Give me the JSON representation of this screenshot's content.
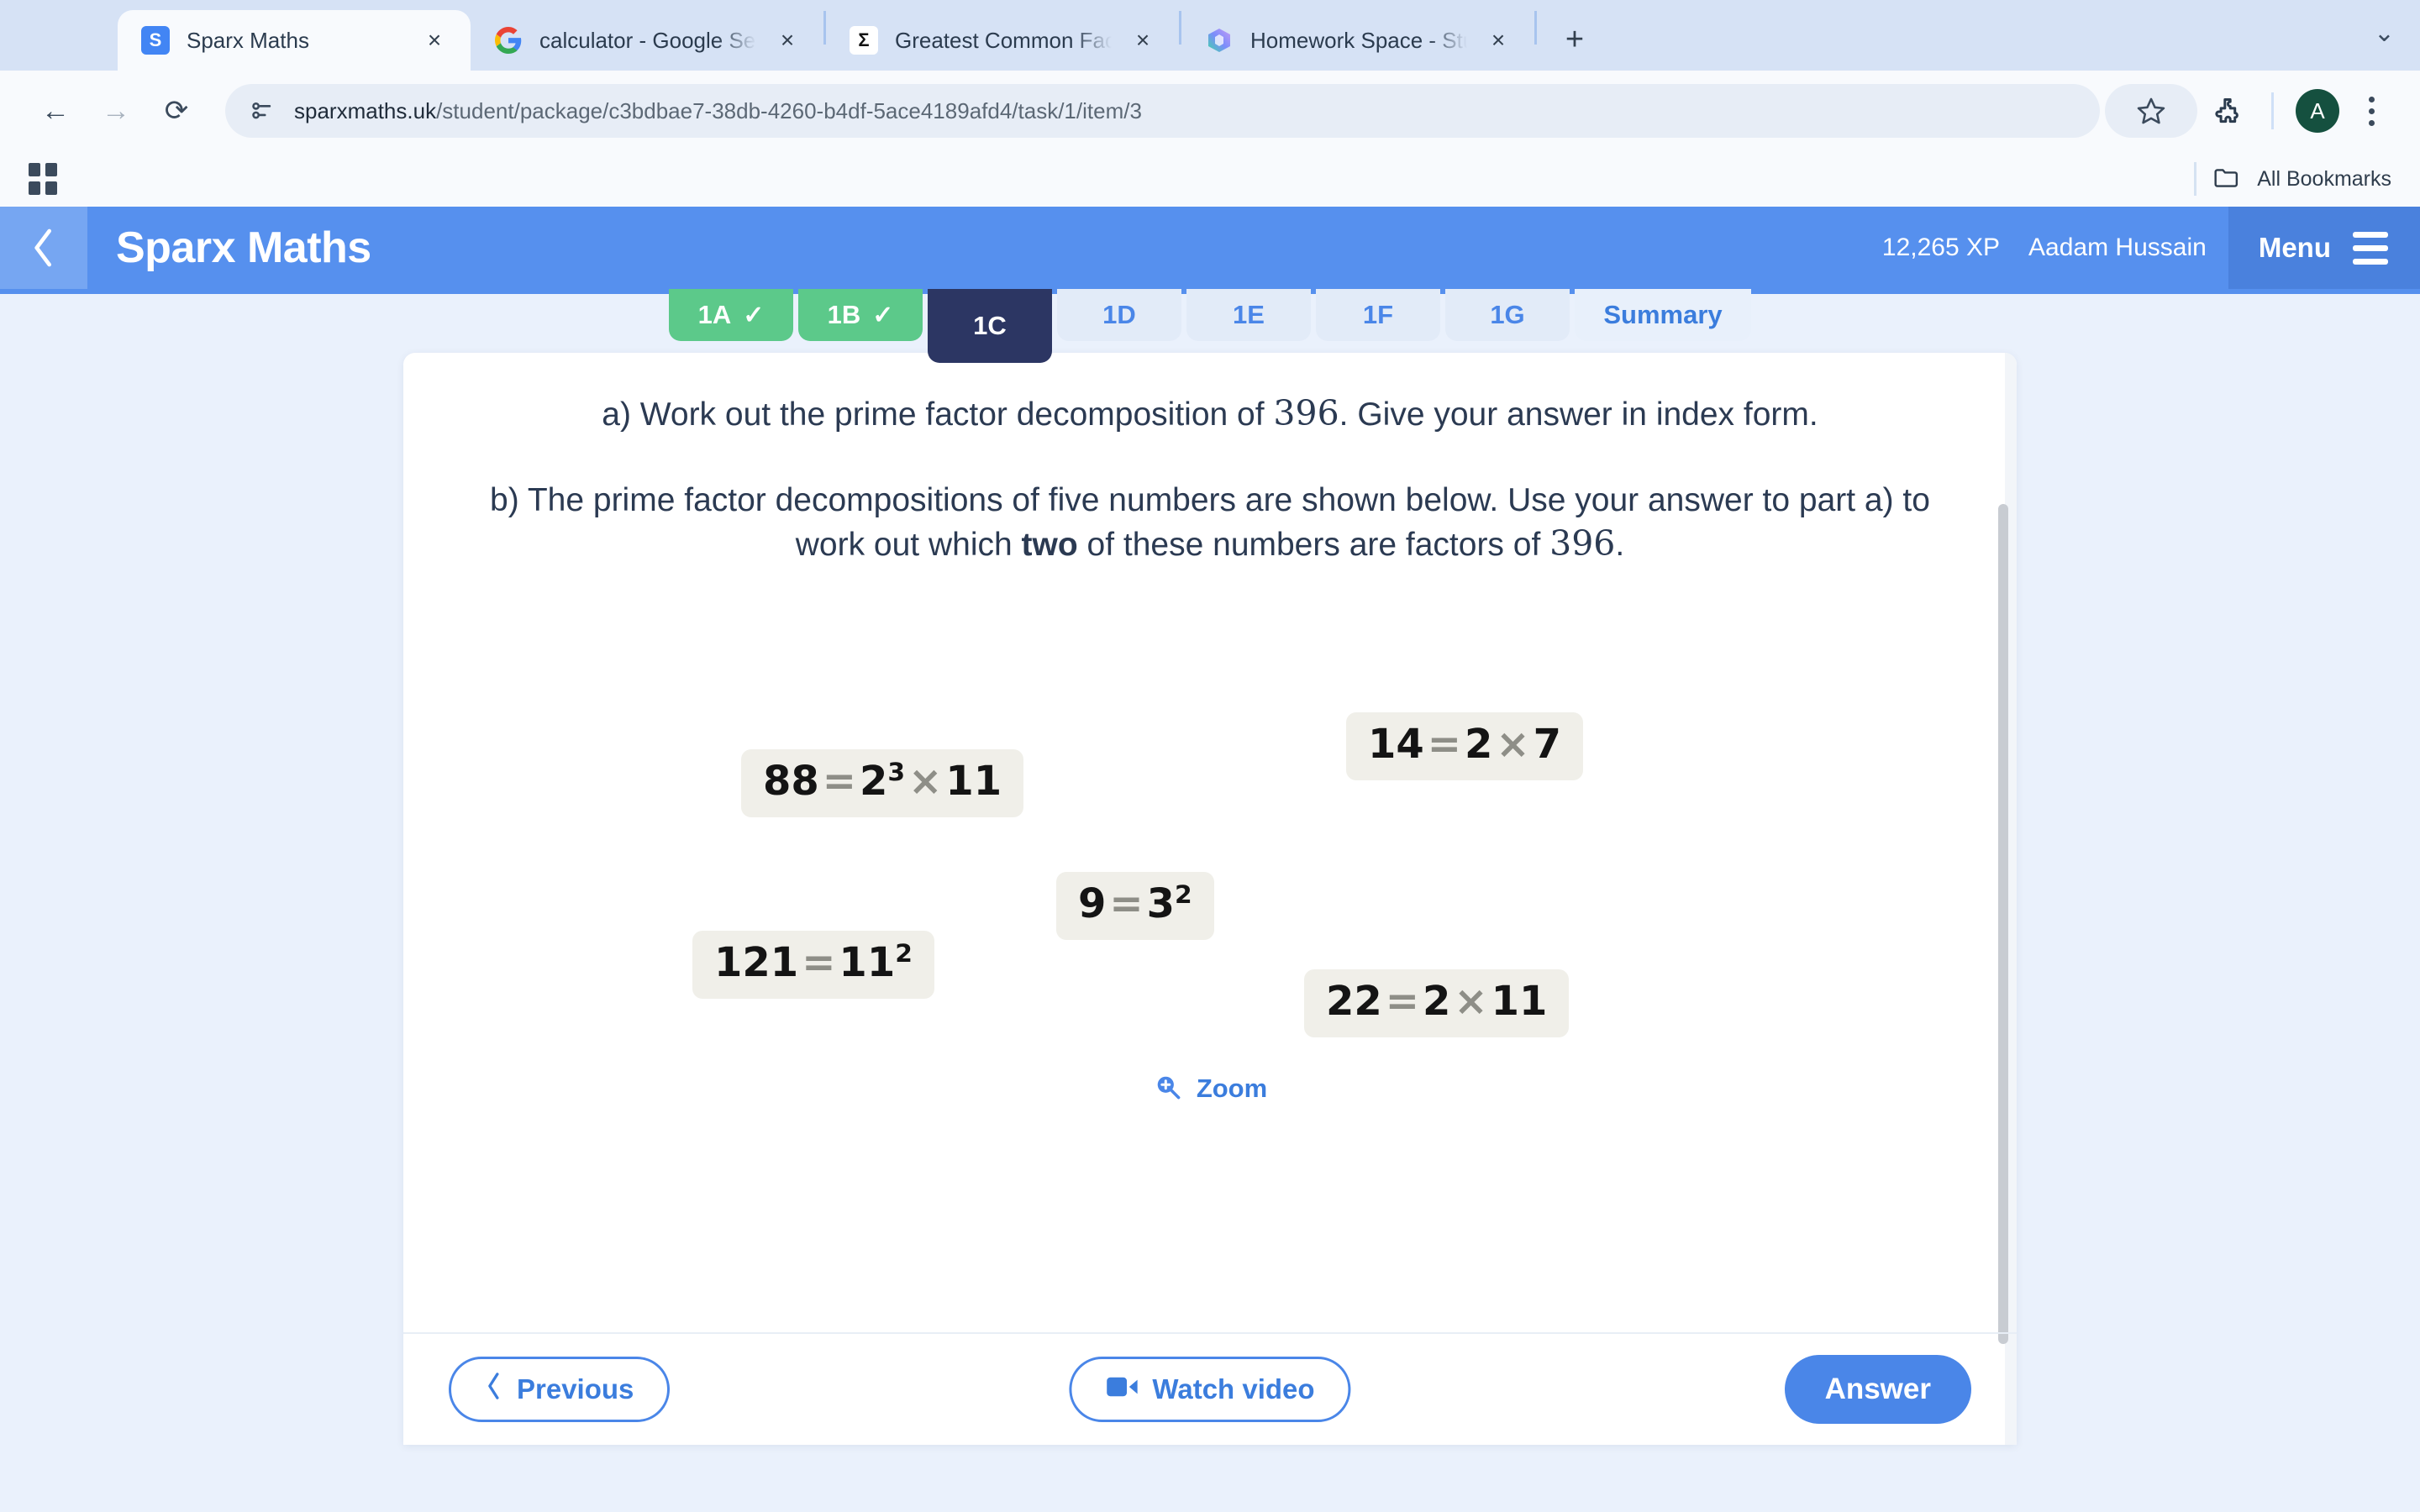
{
  "browser": {
    "tabs": [
      {
        "title": "Sparx Maths",
        "favicon": "sparx-icon",
        "favicon_letter": "S",
        "active": true,
        "close": "×"
      },
      {
        "title": "calculator - Google Search",
        "favicon": "google-icon",
        "favicon_letter": "G",
        "active": false,
        "close": "×"
      },
      {
        "title": "Greatest Common Factor Calc",
        "favicon": "sigma-icon",
        "favicon_letter": "Σ",
        "active": false,
        "close": "×"
      },
      {
        "title": "Homework Space - StudyX",
        "favicon": "studyx-icon",
        "favicon_letter": "",
        "active": false,
        "close": "×"
      }
    ],
    "new_tab_label": "+",
    "window_chevron": "⌄",
    "nav": {
      "back": "←",
      "forward": "→",
      "reload": "⟳"
    },
    "omnibox": {
      "site_info_icon": "site-settings-icon",
      "url_domain": "sparxmaths.uk",
      "url_path": "/student/package/c3bdbae7-38db-4260-b4df-5ace4189afd4/task/1/item/3"
    },
    "bookmark_star": "☆",
    "extensions_icon": "puzzle-icon",
    "profile_letter": "A",
    "menu_icon": "kebab-menu-icon",
    "bookmarks_bar": {
      "apps_icon": "apps-grid-icon",
      "folder_icon": "folder-icon",
      "all_bookmarks_label": "All Bookmarks"
    }
  },
  "sparx": {
    "back_icon": "chevron-left-icon",
    "brand": "Sparx Maths",
    "xp": "12,265 XP",
    "user": "Aadam Hussain",
    "menu_label": "Menu",
    "task_tabs": [
      {
        "label": "1A",
        "state": "done",
        "tick": "✓"
      },
      {
        "label": "1B",
        "state": "done",
        "tick": "✓"
      },
      {
        "label": "1C",
        "state": "current",
        "tick": ""
      },
      {
        "label": "1D",
        "state": "todo",
        "tick": ""
      },
      {
        "label": "1E",
        "state": "todo",
        "tick": ""
      },
      {
        "label": "1F",
        "state": "todo",
        "tick": ""
      },
      {
        "label": "1G",
        "state": "todo",
        "tick": ""
      },
      {
        "label": "Summary",
        "state": "summary",
        "tick": ""
      }
    ],
    "question": {
      "part_a_pre": "a) Work out the prime factor decomposition of ",
      "part_a_number": "396",
      "part_a_post": ". Give your answer in index form.",
      "part_b_pre": "b) The prime factor decompositions of five numbers are shown below. Use your answer to part a) to work out which ",
      "part_b_bold": "two",
      "part_b_mid": " of these numbers are factors of ",
      "part_b_number": "396",
      "part_b_post": "."
    },
    "factor_boxes": [
      {
        "name": "factor-box-88",
        "number": "88",
        "eq": "=",
        "base1": "2",
        "exp1": "3",
        "times": "×",
        "base2": "11"
      },
      {
        "name": "factor-box-14",
        "number": "14",
        "eq": "=",
        "base1": "2",
        "exp1": "",
        "times": "×",
        "base2": "7"
      },
      {
        "name": "factor-box-9",
        "number": "9",
        "eq": "=",
        "base1": "3",
        "exp1": "2",
        "times": "",
        "base2": ""
      },
      {
        "name": "factor-box-121",
        "number": "121",
        "eq": "=",
        "base1": "11",
        "exp1": "2",
        "times": "",
        "base2": ""
      },
      {
        "name": "factor-box-22",
        "number": "22",
        "eq": "=",
        "base1": "2",
        "exp1": "",
        "times": "×",
        "base2": "11"
      }
    ],
    "zoom_label": "Zoom",
    "zoom_icon": "magnifier-plus-icon",
    "previous_label": "Previous",
    "previous_icon": "chevron-left-icon",
    "watch_video_label": "Watch video",
    "watch_video_icon": "video-camera-icon",
    "answer_label": "Answer"
  },
  "colors": {
    "brand_blue": "#5690ee",
    "accent_blue": "#4a86e8",
    "done_green": "#5cc98a",
    "current_navy": "#2c3663",
    "box_beige": "#f0efe9"
  }
}
